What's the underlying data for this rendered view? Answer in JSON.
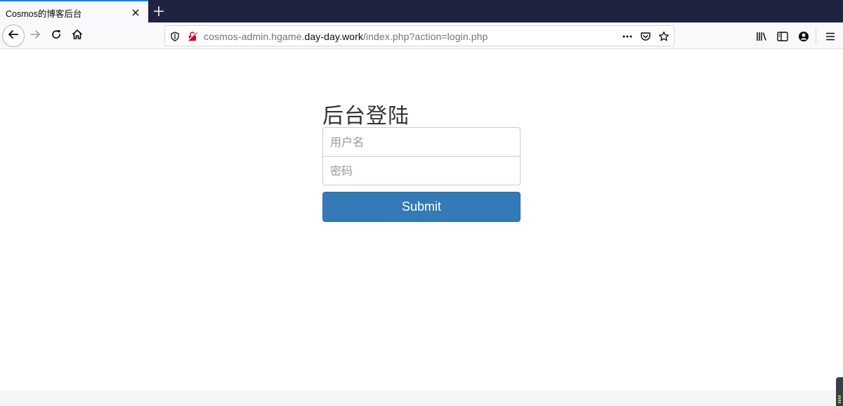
{
  "browser": {
    "tab": {
      "title": "Cosmos的博客后台"
    },
    "urlbar": {
      "prefix": "cosmos-admin.hgame.",
      "domain": "day-day.work",
      "path": "/index.php?action=login.php"
    },
    "icons": {
      "back": "arrow-left-icon",
      "forward": "arrow-right-icon",
      "reload": "reload-icon",
      "home": "home-icon",
      "tracking": "shield-icon",
      "insecure": "insecure-lock-icon",
      "page_actions": "more-dots-icon",
      "pocket": "pocket-icon",
      "bookmark": "star-icon",
      "library": "library-icon",
      "sidebar": "sidebar-icon",
      "account": "account-icon",
      "menu": "hamburger-menu-icon"
    }
  },
  "login": {
    "heading": "后台登陆",
    "username_placeholder": "用户名",
    "password_placeholder": "密码",
    "submit_label": "Submit"
  },
  "colors": {
    "tabstrip": "#202340",
    "primary_button": "#337ab7",
    "heading_text": "#333333"
  }
}
